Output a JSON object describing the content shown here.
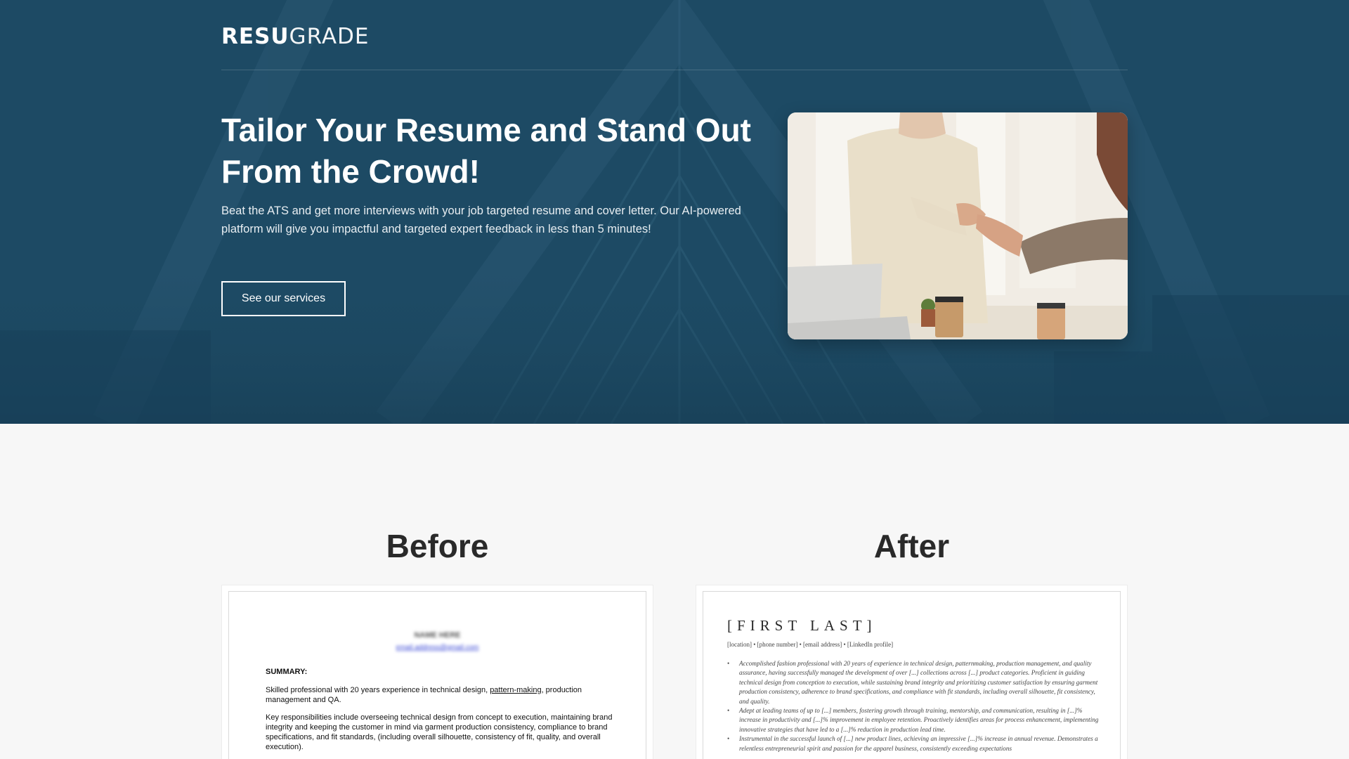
{
  "brand": {
    "logo_bold": "RESU",
    "logo_light": "GRADE"
  },
  "hero": {
    "title": "Tailor Your Resume and Stand Out From the Crowd!",
    "subtitle": "Beat the ATS and get more interviews with your job targeted resume and cover letter. Our AI-powered platform will give you impactful and targeted expert feedback in less than 5 minutes!",
    "cta_label": "See our services",
    "image_icon": "handshake-photo"
  },
  "comparison": {
    "before": {
      "title": "Before",
      "name": "NAME HERE",
      "email": "email.address@gmail.com",
      "summary_heading": "SUMMARY:",
      "summary_pre": "Skilled professional with 20 years experience in technical design, ",
      "summary_link": "pattern-making",
      "summary_post": ", production management and QA.",
      "responsibilities": "Key responsibilities include overseeing technical design from concept to execution, maintaining brand integrity and keeping the customer in mind via garment production consistency, compliance to brand specifications, and fit standards, (including overall silhouette, consistency of fit, quality, and overall execution)."
    },
    "after": {
      "title": "After",
      "name": "[FIRST LAST]",
      "contact": "[location] • [phone number] • [email address] • [LinkedIn profile]",
      "bullets": [
        "Accomplished fashion professional with 20 years of experience in technical design, patternmaking, production management, and quality assurance, having successfully managed the development of over [...] collections across [...] product categories. Proficient in guiding technical design from conception to execution, while sustaining brand integrity and prioritizing customer satisfaction by ensuring garment production consistency, adherence to brand specifications, and compliance with fit standards, including overall silhouette, fit consistency, and quality.",
        "Adept at leading teams of up to [...] members, fostering growth through training, mentorship, and communication, resulting in [...]% increase in productivity and [...]% improvement in employee retention. Proactively identifies areas for process enhancement, implementing innovative strategies that have led to a [...]% reduction in production lead time.",
        "Instrumental in the successful launch of [...] new product lines, achieving an impressive [...]% increase in annual revenue. Demonstrates a relentless entrepreneurial spirit and passion for the apparel business, consistently exceeding expectations"
      ]
    }
  },
  "colors": {
    "hero_bg": "#1d4a64",
    "page_bg": "#f7f7f7",
    "heading": "#2a2a2a"
  }
}
